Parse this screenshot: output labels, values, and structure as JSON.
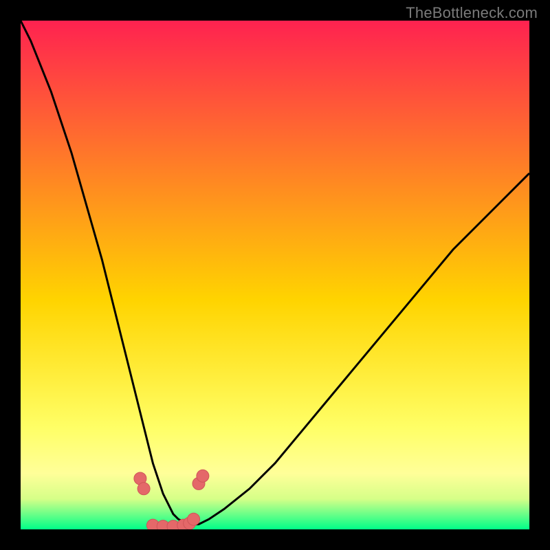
{
  "watermark": "TheBottleneck.com",
  "colors": {
    "frame": "#000000",
    "top_grad": "#ff2250",
    "mid_grad": "#ffd400",
    "pale_grad": "#ffff99",
    "bottom_grad": "#00ff88",
    "curve": "#000000",
    "marker_fill": "#e46869"
  },
  "chart_data": {
    "type": "line",
    "title": "",
    "xlabel": "",
    "ylabel": "",
    "xlim": [
      0,
      100
    ],
    "ylim": [
      0,
      100
    ],
    "series": [
      {
        "name": "curve",
        "x": [
          0,
          2,
          4,
          6,
          8,
          10,
          12,
          14,
          16,
          18,
          20,
          21,
          22,
          23,
          24,
          25,
          26,
          27,
          28,
          29,
          30,
          31,
          32,
          33,
          34,
          35,
          37,
          40,
          45,
          50,
          55,
          60,
          65,
          70,
          75,
          80,
          85,
          90,
          95,
          100
        ],
        "y": [
          100,
          96,
          91,
          86,
          80,
          74,
          67,
          60,
          53,
          45,
          37,
          33,
          29,
          25,
          21,
          17,
          13,
          10,
          7,
          5,
          3,
          2,
          1.5,
          1,
          1,
          1,
          2,
          4,
          8,
          13,
          19,
          25,
          31,
          37,
          43,
          49,
          55,
          60,
          65,
          70
        ]
      }
    ],
    "markers": {
      "x": [
        23.5,
        24.2,
        26,
        28,
        30,
        32,
        33.2,
        34,
        35,
        35.8
      ],
      "y": [
        10,
        8,
        0.8,
        0.6,
        0.6,
        0.8,
        1.2,
        2,
        9,
        10.5
      ]
    }
  }
}
